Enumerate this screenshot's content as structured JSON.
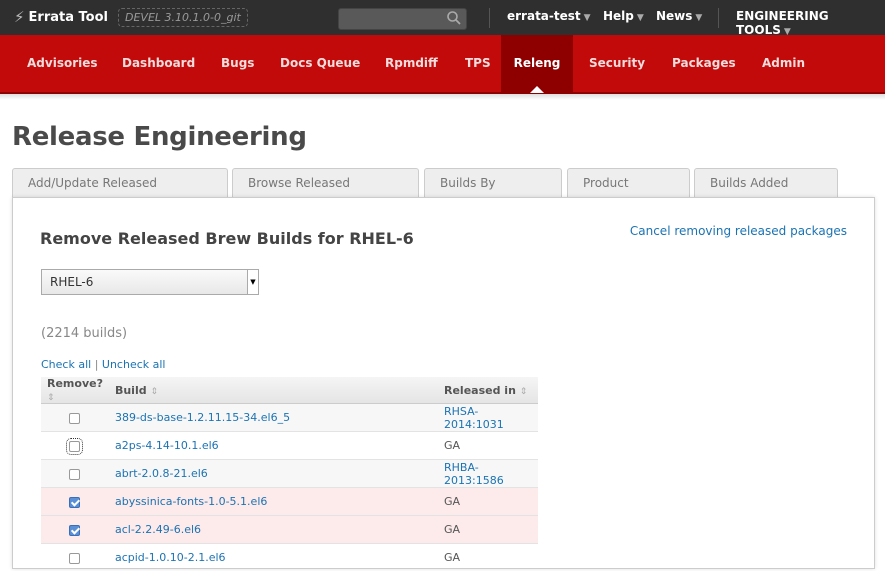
{
  "app": {
    "title": "Errata Tool",
    "version": "DEVEL 3.10.1.0-0_git",
    "user_menu": "errata-test",
    "help_menu": "Help",
    "news_menu": "News",
    "tools_menu": "ENGINEERING TOOLS"
  },
  "nav": {
    "items": [
      "Advisories",
      "Dashboard",
      "Bugs",
      "Docs Queue",
      "Rpmdiff",
      "TPS",
      "Releng",
      "Security",
      "Packages",
      "Admin"
    ],
    "active": "Releng"
  },
  "page": {
    "title": "Release Engineering",
    "tabs": [
      "Add/Update Released Packages",
      "Browse Released Packages",
      "Builds By Advisory",
      "Product Listings",
      "Builds Added Since"
    ]
  },
  "panel": {
    "heading": "Remove Released Brew Builds for RHEL-6",
    "cancel_link": "Cancel removing released packages",
    "product_select": "RHEL-6",
    "build_count": "(2214 builds)",
    "check_all": "Check all",
    "check_sep": "|",
    "uncheck_all": "Uncheck all"
  },
  "table": {
    "headers": [
      "Remove?",
      "Build",
      "Released in"
    ],
    "rows": [
      {
        "build": "389-ds-base-1.2.11.15-34.el6_5",
        "released": "RHSA-2014:1031",
        "released_link": true,
        "checked": false
      },
      {
        "build": "a2ps-4.14-10.1.el6",
        "released": "GA",
        "released_link": false,
        "checked": false
      },
      {
        "build": "abrt-2.0.8-21.el6",
        "released": "RHBA-2013:1586",
        "released_link": true,
        "checked": false
      },
      {
        "build": "abyssinica-fonts-1.0-5.1.el6",
        "released": "GA",
        "released_link": false,
        "checked": true
      },
      {
        "build": "acl-2.2.49-6.el6",
        "released": "GA",
        "released_link": false,
        "checked": true
      },
      {
        "build": "acpid-1.0.10-2.1.el6",
        "released": "GA",
        "released_link": false,
        "checked": false
      }
    ]
  },
  "colors": {
    "topbar": "#2f2f2f",
    "nav_red": "#c20a0a",
    "nav_active": "#8e0000",
    "link": "#1b73b3",
    "checked_row": "#fdeaea"
  }
}
